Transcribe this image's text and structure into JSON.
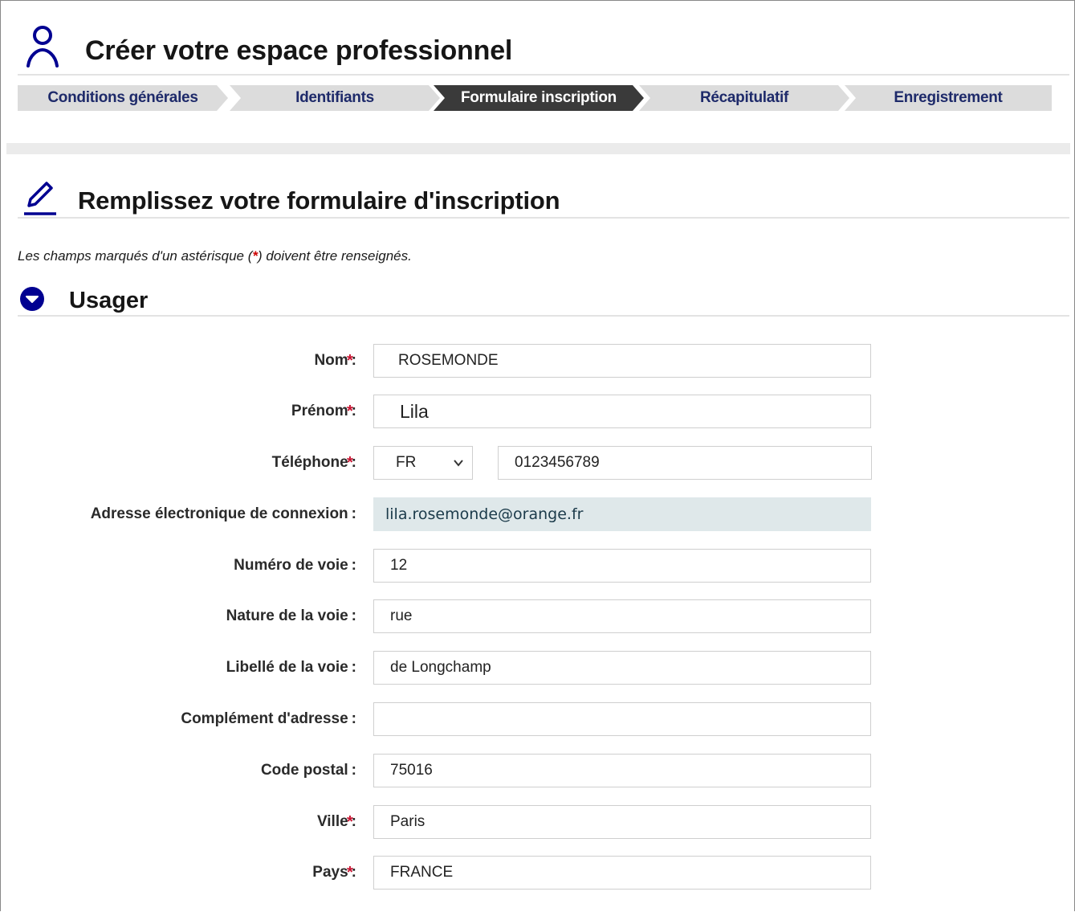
{
  "header": {
    "title": "Créer votre espace professionnel",
    "icon": "user-icon"
  },
  "stepper": {
    "steps": [
      {
        "label": "Conditions générales",
        "active": false
      },
      {
        "label": "Identifiants",
        "active": false
      },
      {
        "label": "Formulaire inscription",
        "active": true
      },
      {
        "label": "Récapitulatif",
        "active": false
      },
      {
        "label": "Enregistrement",
        "active": false
      }
    ]
  },
  "form": {
    "title": "Remplissez votre formulaire d'inscription",
    "icon": "pencil-icon",
    "note_before": "Les champs marqués d'un astérisque (",
    "note_star": "*",
    "note_after": ") doivent être renseignés."
  },
  "usager": {
    "title": "Usager",
    "icon": "chevron-down-circle-icon",
    "fields": {
      "nom": {
        "label": "Nom",
        "value": "ROSEMONDE",
        "required": true
      },
      "prenom": {
        "label": "Prénom",
        "value": "Lila",
        "required": true
      },
      "telephone": {
        "label": "Téléphone",
        "country": "FR",
        "value": "0123456789",
        "required": true
      },
      "email": {
        "label": "Adresse électronique de connexion",
        "value": "lila.rosemonde@orange.fr",
        "required": false
      },
      "numero_voie": {
        "label": "Numéro de voie",
        "value": "12",
        "required": false
      },
      "nature_voie": {
        "label": "Nature de la voie",
        "value": "rue",
        "required": false
      },
      "libelle_voie": {
        "label": "Libellé de la voie",
        "value": "de Longchamp",
        "required": false
      },
      "complement": {
        "label": "Complément d'adresse",
        "value": "",
        "required": false
      },
      "code_postal": {
        "label": "Code postal",
        "value": "75016",
        "required": false
      },
      "ville": {
        "label": "Ville",
        "value": "Paris",
        "required": true
      },
      "pays": {
        "label": "Pays",
        "value": "FRANCE",
        "required": true
      }
    },
    "colon": ":",
    "required_mark": "*"
  },
  "colors": {
    "primary": "#000091",
    "step_bg": "#dcdcdc",
    "step_active_bg": "#3a3a3a",
    "required": "#c8102e",
    "readonly_bg": "#dfe8ea"
  }
}
